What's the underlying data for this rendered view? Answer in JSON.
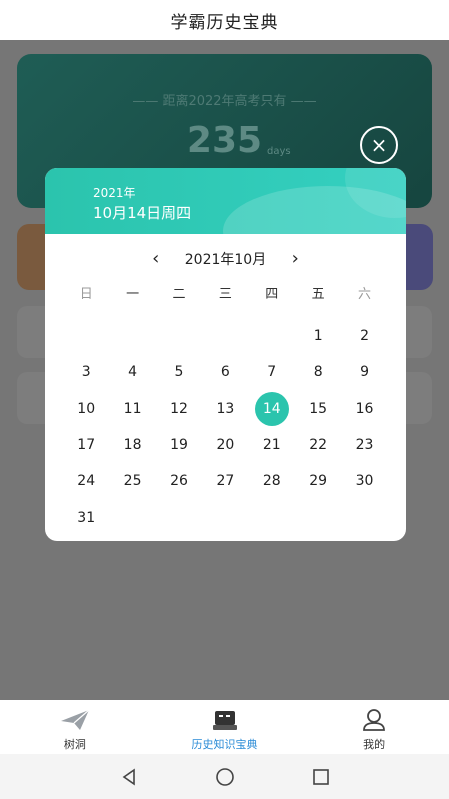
{
  "app": {
    "title": "学霸历史宝典"
  },
  "countdown": {
    "headline": "—— 距离2022年高考只有 ——",
    "number": "235",
    "unit": "days"
  },
  "datepicker": {
    "header_year": "2021年",
    "header_date": "10月14日周四",
    "month_label": "2021年10月",
    "prev_label": "‹",
    "next_label": "›",
    "weekdays": [
      "日",
      "一",
      "二",
      "三",
      "四",
      "五",
      "六"
    ],
    "weeks": [
      [
        "",
        "",
        "",
        "",
        "",
        "1",
        "2"
      ],
      [
        "3",
        "4",
        "5",
        "6",
        "7",
        "8",
        "9"
      ],
      [
        "10",
        "11",
        "12",
        "13",
        "14",
        "15",
        "16"
      ],
      [
        "17",
        "18",
        "19",
        "20",
        "21",
        "22",
        "23"
      ],
      [
        "24",
        "25",
        "26",
        "27",
        "28",
        "29",
        "30"
      ],
      [
        "31",
        "",
        "",
        "",
        "",
        "",
        ""
      ]
    ],
    "selected_day": "14",
    "accent_color": "#2bc4ad"
  },
  "close_button": {
    "icon": "close-icon",
    "label": "×"
  },
  "bottom_nav": {
    "items": [
      {
        "label": "树洞",
        "icon": "paper-plane-icon"
      },
      {
        "label": "历史知识宝典",
        "icon": "book-icon"
      },
      {
        "label": "我的",
        "icon": "user-icon"
      }
    ],
    "active_index": 1,
    "active_color": "#2a8bd6"
  },
  "system_nav": {
    "back": "back-icon",
    "home": "home-icon",
    "recents": "recents-icon"
  }
}
